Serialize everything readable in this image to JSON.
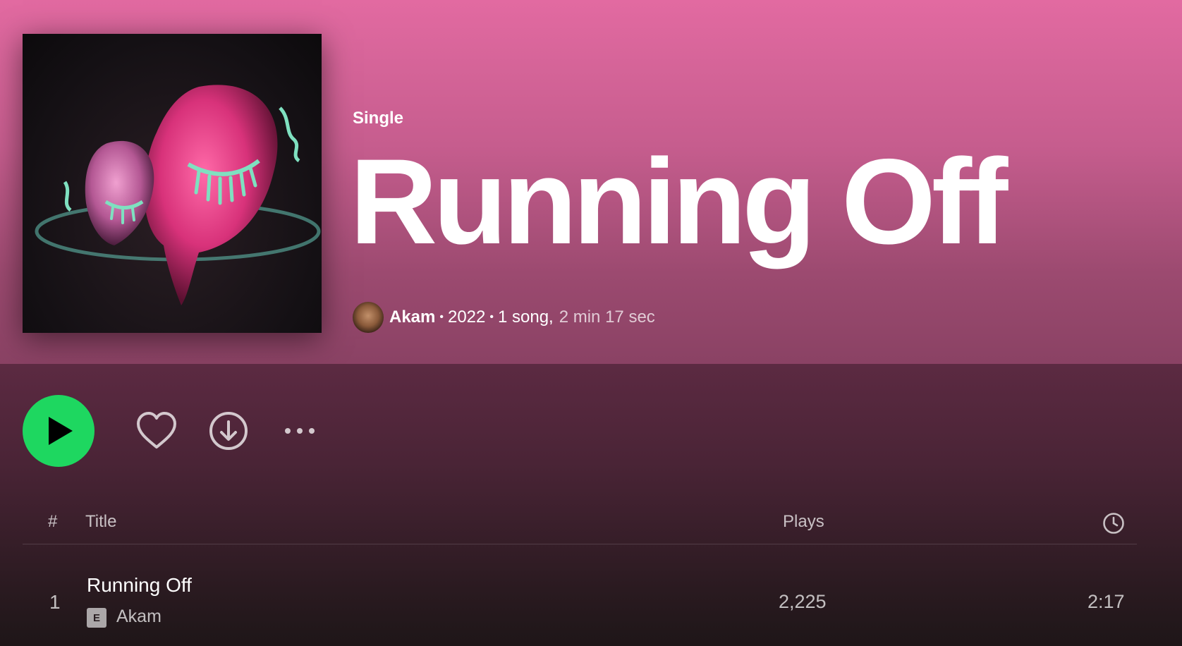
{
  "album": {
    "kind": "Single",
    "title": "Running Off",
    "artist": "Akam",
    "year": "2022",
    "song_count": "1 song,",
    "duration": "2 min 17 sec"
  },
  "controls": {
    "play_icon": "play-icon",
    "like_icon": "heart-icon",
    "download_icon": "download-icon",
    "more_icon": "more-options-icon"
  },
  "table": {
    "columns": {
      "number": "#",
      "title": "Title",
      "plays": "Plays",
      "duration_icon": "clock-icon"
    },
    "rows": [
      {
        "number": "1",
        "title": "Running Off",
        "explicit": "E",
        "artist": "Akam",
        "plays": "2,225",
        "duration": "2:17"
      }
    ]
  },
  "colors": {
    "header_gradient_top": "#e26aa1",
    "play_button": "#1ed760",
    "background_dark": "#1a1416"
  }
}
